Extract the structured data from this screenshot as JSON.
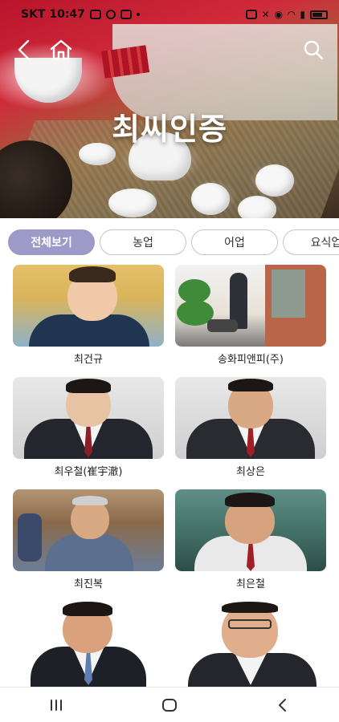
{
  "status_bar": {
    "carrier_time": "SKT 10:47"
  },
  "hero": {
    "title": "최씨인증"
  },
  "tabs": [
    {
      "label": "전체보기",
      "active": true
    },
    {
      "label": "농업",
      "active": false
    },
    {
      "label": "어업",
      "active": false
    },
    {
      "label": "요식업",
      "active": false
    }
  ],
  "people": [
    {
      "name": "최건규"
    },
    {
      "name": "송화피앤피(주)"
    },
    {
      "name": "최우철(崔宇澈)"
    },
    {
      "name": "최상은"
    },
    {
      "name": "최진복"
    },
    {
      "name": "최은철"
    },
    {
      "name": ""
    },
    {
      "name": ""
    }
  ],
  "icons": {
    "back": "chevron-left-icon",
    "home": "home-icon",
    "search": "search-icon",
    "recents": "recents-icon",
    "nav_home": "nav-home-icon",
    "nav_back": "nav-back-icon"
  },
  "colors": {
    "tab_active_bg": "#9c9ac6",
    "tab_border": "#c5c5c5"
  }
}
